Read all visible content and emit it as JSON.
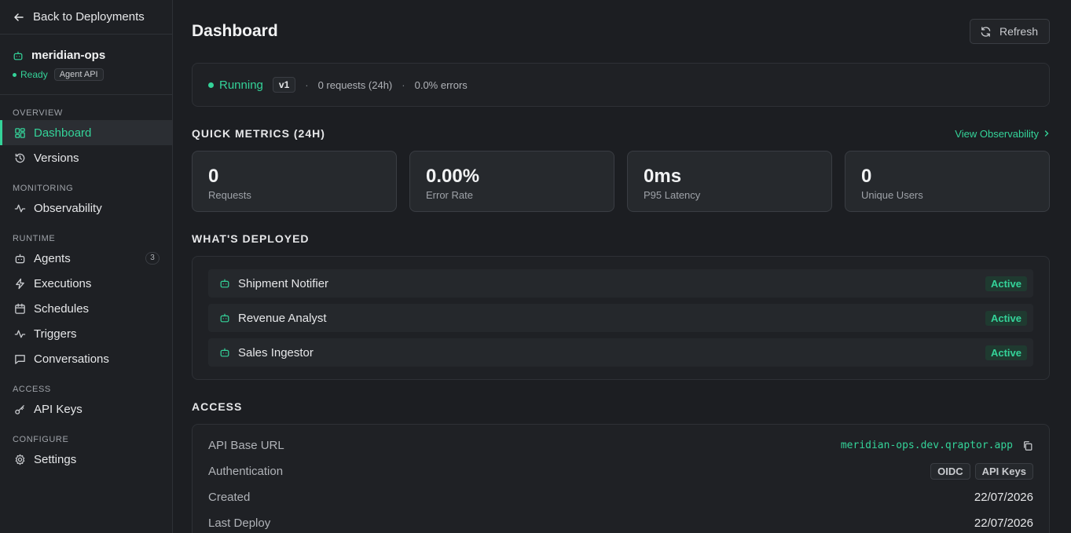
{
  "sidebar": {
    "back_label": "Back to Deployments",
    "project_name": "meridian-ops",
    "status": "Ready",
    "type_chip": "Agent API",
    "sections": {
      "overview": "OVERVIEW",
      "monitoring": "MONITORING",
      "runtime": "RUNTIME",
      "access": "ACCESS",
      "configure": "CONFIGURE"
    },
    "items": {
      "dashboard": "Dashboard",
      "versions": "Versions",
      "observability": "Observability",
      "agents": "Agents",
      "agents_count": "3",
      "executions": "Executions",
      "schedules": "Schedules",
      "triggers": "Triggers",
      "conversations": "Conversations",
      "api_keys": "API Keys",
      "settings": "Settings"
    },
    "accent_color": "#34d399"
  },
  "header": {
    "title": "Dashboard",
    "refresh_label": "Refresh"
  },
  "status_bar": {
    "state": "Running",
    "version": "v1",
    "separator": "·",
    "requests": "0 requests (24h)",
    "errors": "0.0% errors"
  },
  "quick_metrics": {
    "title": "QUICK METRICS (24H)",
    "link": "View Observability",
    "items": [
      {
        "value": "0",
        "label": "Requests"
      },
      {
        "value": "0.00%",
        "label": "Error Rate"
      },
      {
        "value": "0ms",
        "label": "P95 Latency"
      },
      {
        "value": "0",
        "label": "Unique Users"
      }
    ]
  },
  "deployed": {
    "title": "WHAT'S DEPLOYED",
    "agents": [
      {
        "name": "Shipment Notifier",
        "status": "Active"
      },
      {
        "name": "Revenue Analyst",
        "status": "Active"
      },
      {
        "name": "Sales Ingestor",
        "status": "Active"
      }
    ]
  },
  "access": {
    "title": "ACCESS",
    "rows": {
      "base_url_label": "API Base URL",
      "base_url": "meridian-ops.dev.qraptor.app",
      "auth_label": "Authentication",
      "auth_methods": [
        "OIDC",
        "API Keys"
      ],
      "created_label": "Created",
      "created": "22/07/2026",
      "last_deploy_label": "Last Deploy",
      "last_deploy": "22/07/2026"
    }
  }
}
